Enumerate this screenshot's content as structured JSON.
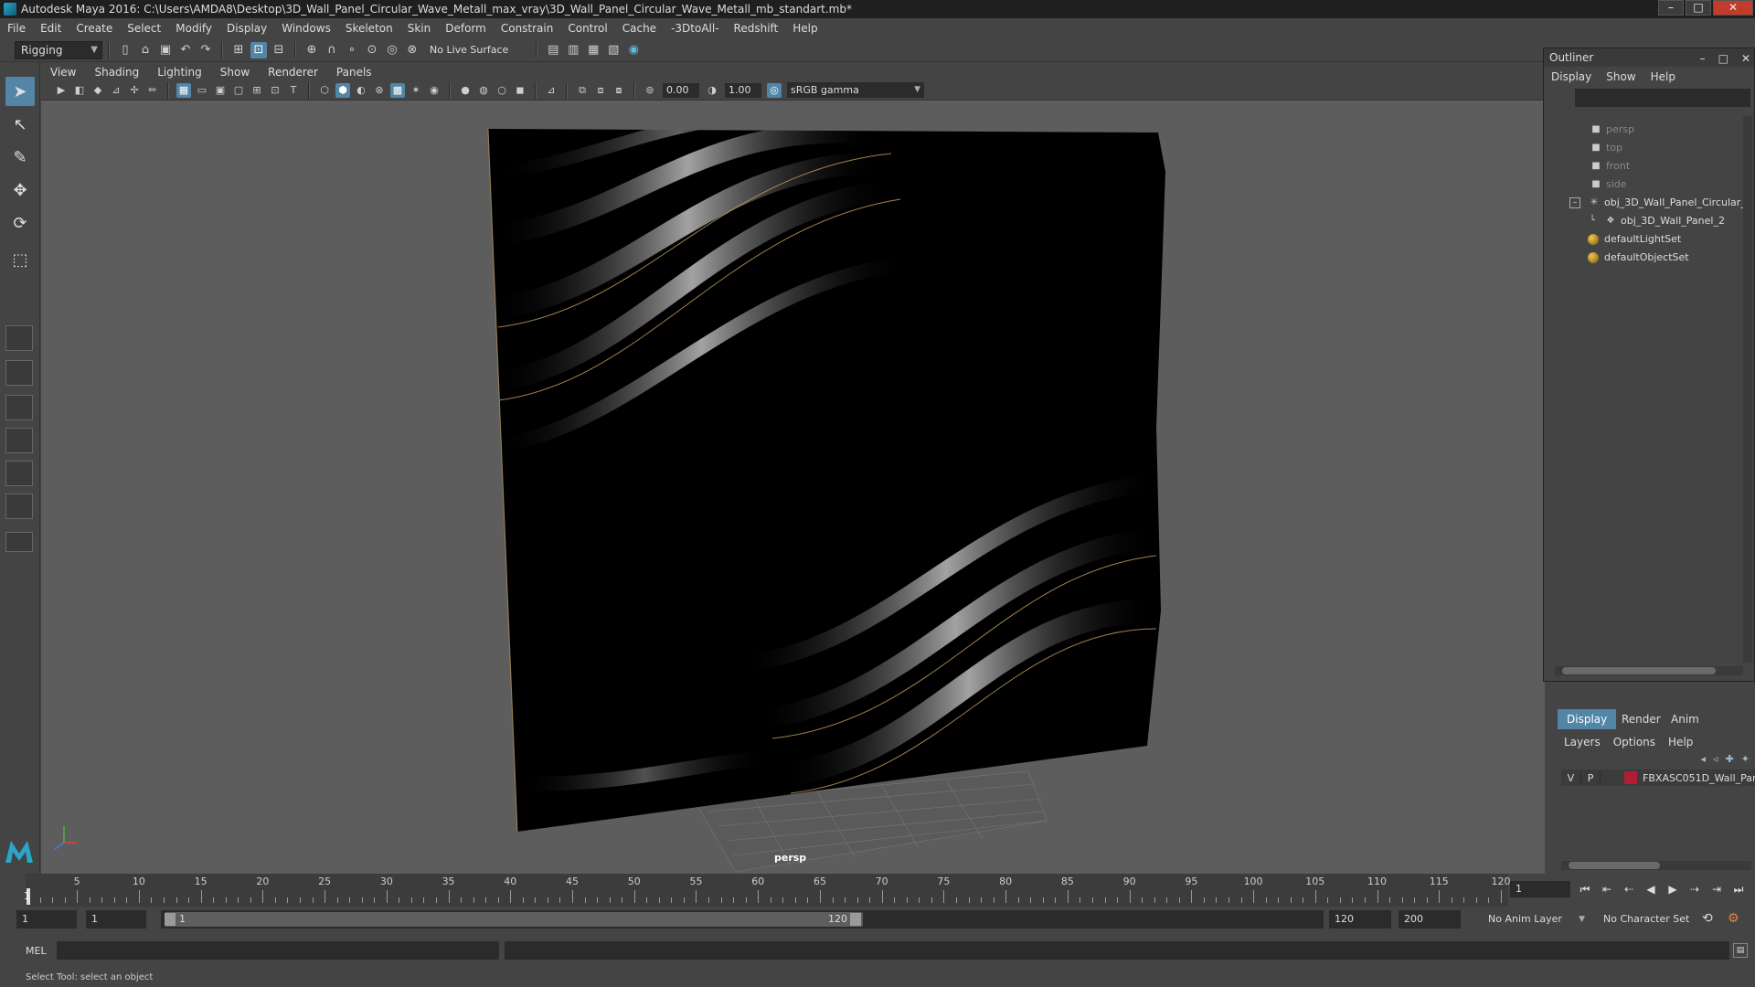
{
  "window": {
    "title": "Autodesk Maya 2016: C:\\Users\\AMDA8\\Desktop\\3D_Wall_Panel_Circular_Wave_Metall_max_vray\\3D_Wall_Panel_Circular_Wave_Metall_mb_standart.mb*",
    "minimize": "–",
    "maximize": "□",
    "close": "✕"
  },
  "menubar": [
    "File",
    "Edit",
    "Create",
    "Select",
    "Modify",
    "Display",
    "Windows",
    "Skeleton",
    "Skin",
    "Deform",
    "Constrain",
    "Control",
    "Cache",
    "-3DtoAll-",
    "Redshift",
    "Help"
  ],
  "statusline": {
    "menuset": "Rigging",
    "live_surface": "No Live Surface"
  },
  "viewport": {
    "menu": [
      "View",
      "Shading",
      "Lighting",
      "Show",
      "Renderer",
      "Panels"
    ],
    "exposure": "0.00",
    "gamma_value": "1.00",
    "color_space": "sRGB gamma",
    "camera_label": "persp"
  },
  "outliner": {
    "title": "Outliner",
    "menu": [
      "Display",
      "Show",
      "Help"
    ],
    "items": [
      {
        "label": "persp",
        "icon": "camera-icon"
      },
      {
        "label": "top",
        "icon": "camera-icon"
      },
      {
        "label": "front",
        "icon": "camera-icon"
      },
      {
        "label": "side",
        "icon": "camera-icon"
      },
      {
        "label": "obj_3D_Wall_Panel_Circular_",
        "icon": "group-icon"
      },
      {
        "label": "obj_3D_Wall_Panel_2",
        "icon": "mesh-icon"
      },
      {
        "label": "defaultLightSet",
        "icon": "set-icon"
      },
      {
        "label": "defaultObjectSet",
        "icon": "set-icon"
      }
    ]
  },
  "layers": {
    "tabs": [
      "Display",
      "Render",
      "Anim"
    ],
    "menu": [
      "Layers",
      "Options",
      "Help"
    ],
    "row": {
      "v": "V",
      "p": "P",
      "name": "FBXASC051D_Wall_Par",
      "color": "#b01d35"
    }
  },
  "timeline": {
    "ticks": [
      5,
      10,
      15,
      20,
      25,
      30,
      35,
      40,
      45,
      50,
      55,
      60,
      65,
      70,
      75,
      80,
      85,
      90,
      95,
      100,
      105,
      110,
      115,
      120
    ],
    "start_label": "1",
    "current_frame": "1",
    "range_start": "1",
    "range_start2": "1",
    "range_inner_start": "1",
    "range_inner_end": "120",
    "range_end": "120",
    "anim_end": "200",
    "anim_layer": "No Anim Layer",
    "character_set": "No Character Set"
  },
  "command": {
    "label": "MEL",
    "help": "Select Tool: select an object"
  },
  "colors": {
    "accent": "#5285a6",
    "background": "#5d5d5d",
    "panel": "#444444"
  }
}
